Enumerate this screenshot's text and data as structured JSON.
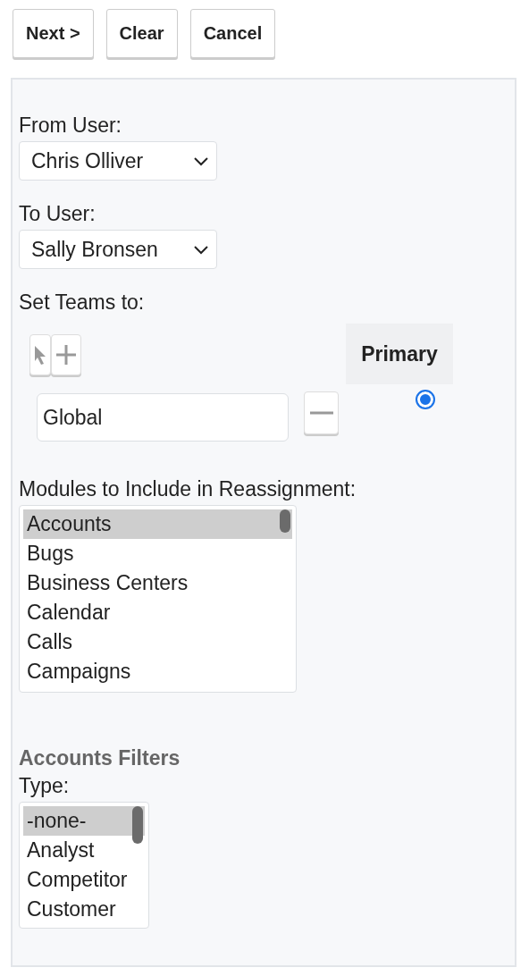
{
  "buttons": [
    {
      "label": "Next >"
    },
    {
      "label": "Clear"
    },
    {
      "label": "Cancel"
    }
  ],
  "from_user": {
    "label": "From User:",
    "value": "Chris Olliver"
  },
  "to_user": {
    "label": "To User:",
    "value": "Sally Bronsen"
  },
  "teams": {
    "label": "Set Teams to:",
    "primary_header": "Primary",
    "rows": [
      {
        "value": "Global",
        "selected": true
      }
    ]
  },
  "modules": {
    "label": "Modules to Include in Reassignment:",
    "items": [
      {
        "label": "Accounts",
        "selected": true
      },
      {
        "label": "Bugs",
        "selected": false
      },
      {
        "label": "Business Centers",
        "selected": false
      },
      {
        "label": "Calendar",
        "selected": false
      },
      {
        "label": "Calls",
        "selected": false
      },
      {
        "label": "Campaigns",
        "selected": false
      }
    ]
  },
  "filters": {
    "title": "Accounts Filters",
    "type_label": "Type:",
    "items": [
      {
        "label": "-none-",
        "selected": true
      },
      {
        "label": "Analyst",
        "selected": false
      },
      {
        "label": "Competitor",
        "selected": false
      },
      {
        "label": "Customer",
        "selected": false
      }
    ]
  }
}
